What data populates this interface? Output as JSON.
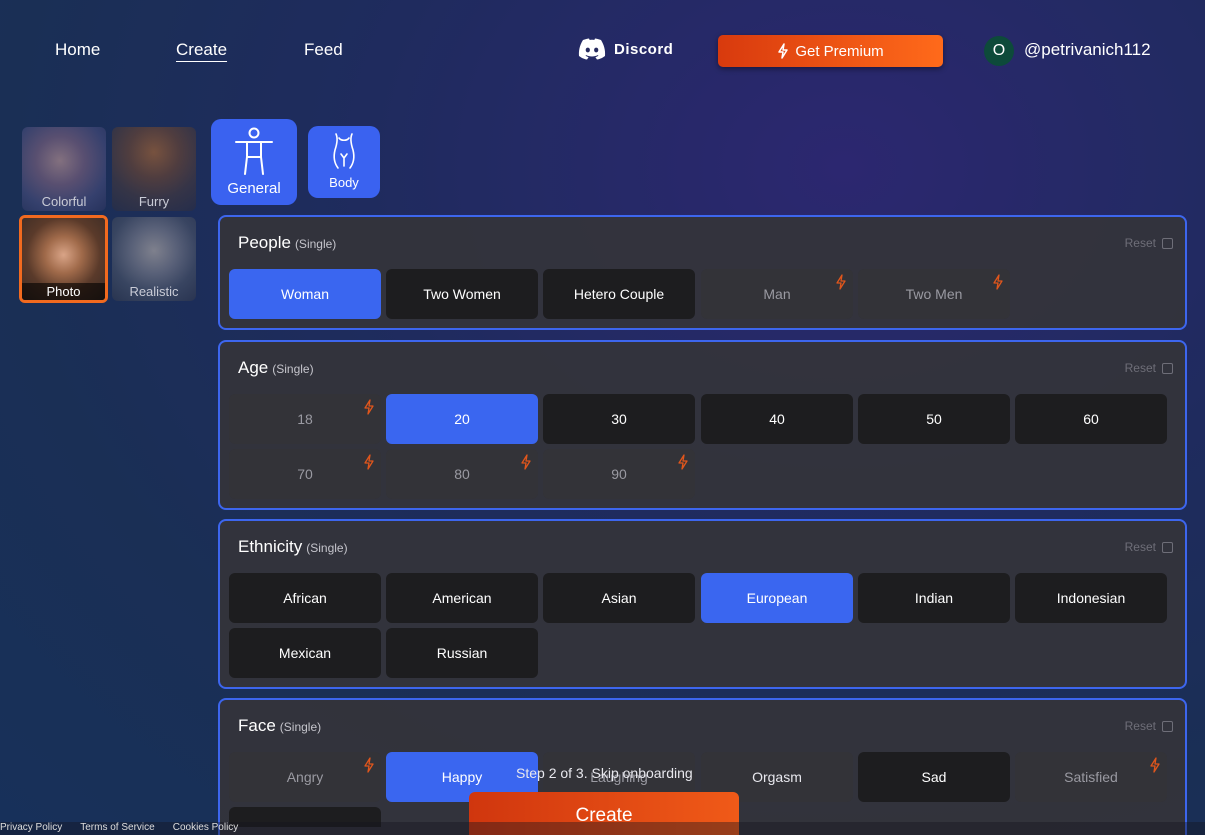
{
  "nav": {
    "home": "Home",
    "create": "Create",
    "feed": "Feed",
    "discord": "Discord",
    "premium": "Get Premium",
    "avatar_initial": "O",
    "username": "@petrivanich112"
  },
  "styles": [
    {
      "label": "Colorful"
    },
    {
      "label": "Furry"
    },
    {
      "label": "Photo"
    },
    {
      "label": "Realistic"
    }
  ],
  "tabs": {
    "general": "General",
    "body": "Body"
  },
  "reset_label": "Reset",
  "single_label": "(Single)",
  "sections": {
    "people": {
      "title": "People",
      "options": [
        "Woman",
        "Two Women",
        "Hetero Couple",
        "Man",
        "Two Men"
      ]
    },
    "age": {
      "title": "Age",
      "options": [
        "18",
        "20",
        "30",
        "40",
        "50",
        "60",
        "70",
        "80",
        "90"
      ]
    },
    "ethnicity": {
      "title": "Ethnicity",
      "options": [
        "African",
        "American",
        "Asian",
        "European",
        "Indian",
        "Indonesian",
        "Mexican",
        "Russian"
      ]
    },
    "face": {
      "title": "Face",
      "options": [
        "Angry",
        "Happy",
        "Laughing",
        "Orgasm",
        "Sad",
        "Satisfied"
      ]
    }
  },
  "onboarding_text": "Step 2 of 3. Skip onboarding",
  "create_label": "Create",
  "footer": {
    "privacy": "Privacy Policy",
    "terms": "Terms of Service",
    "cookies": "Cookies Policy"
  },
  "colors": {
    "accent_blue": "#3a66f0",
    "premium_orange": "#ff6a1a",
    "section_border": "#3d66ee",
    "lock_orange": "#e0561c"
  }
}
